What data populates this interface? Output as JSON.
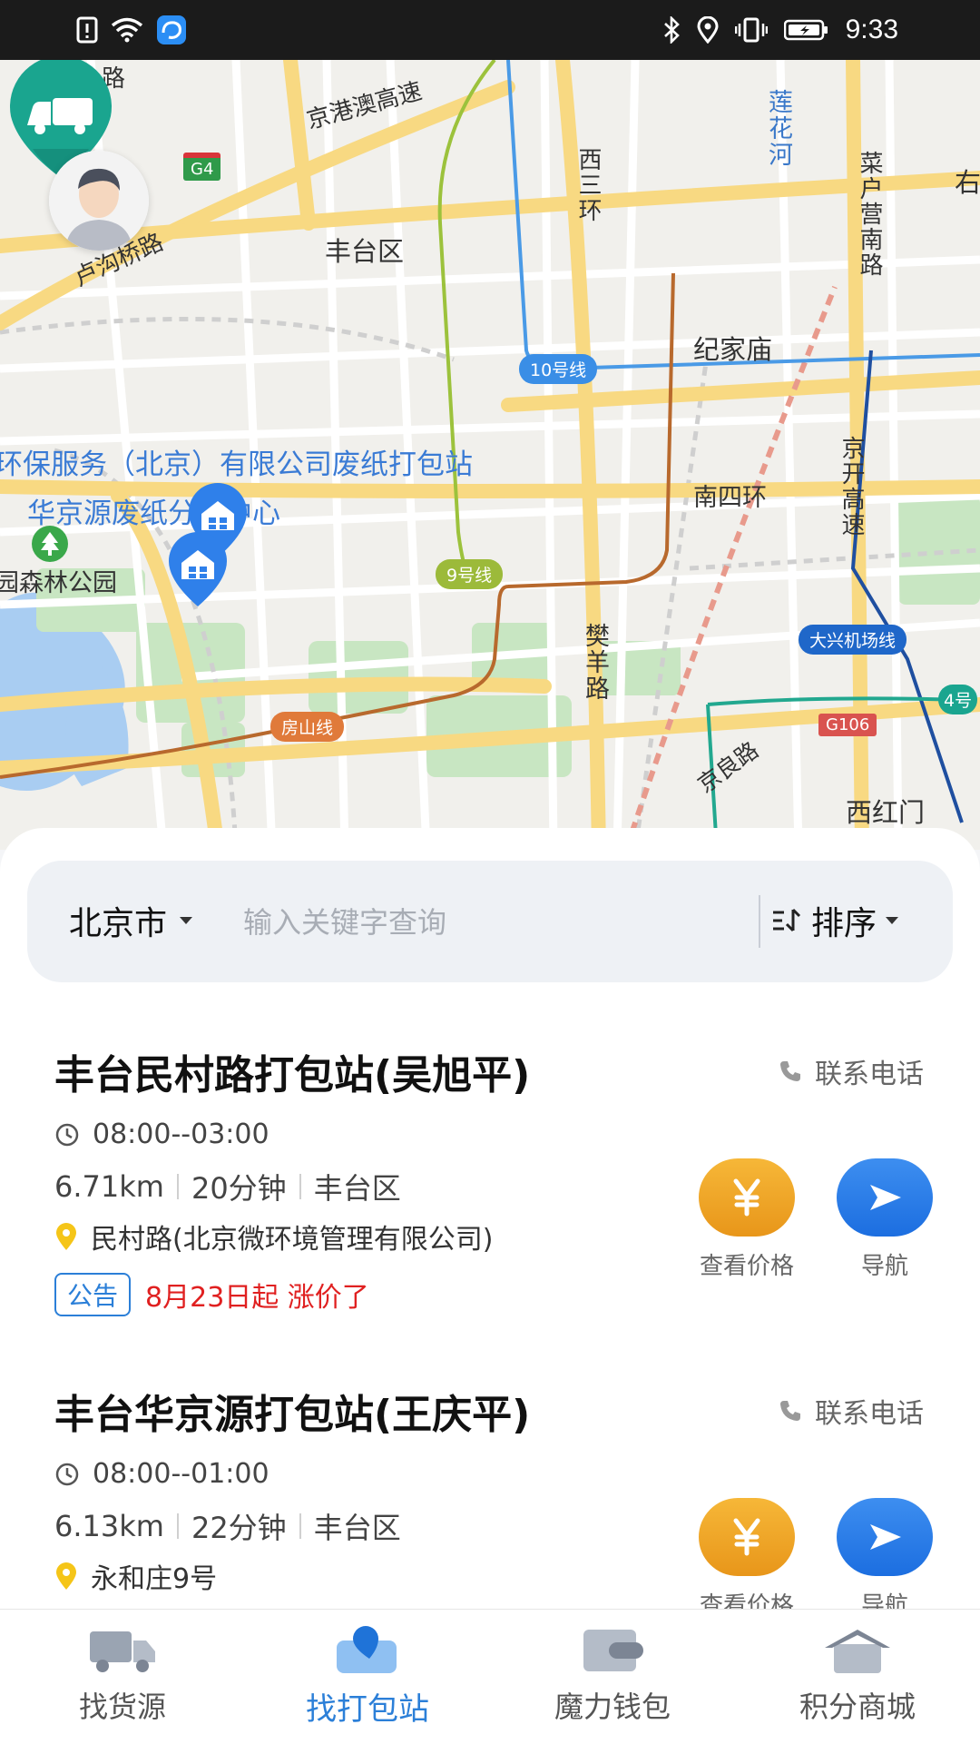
{
  "status_bar": {
    "time": "9:33"
  },
  "map": {
    "labels": {
      "district": "丰台区",
      "jingang": "京港澳高速",
      "lugou": "卢沟桥路",
      "xisanhuan": "西三环",
      "lianhuahe": "莲花河",
      "caihu": "菜户营南路",
      "jijiamiao": "纪家庙",
      "nansihuan": "南四环",
      "jingkai": "京开高速",
      "fanyang": "樊羊路",
      "jingliang": "京良路",
      "xihongmen": "西红门",
      "poi_paper": "环保服务（北京）有限公司废纸打包站",
      "poi_huajing": "华京源废纸分拣中心",
      "park": "园森林公园",
      "top_road": "路",
      "right_edge": "右"
    },
    "badges": {
      "line10": "10号线",
      "line9": "9号线",
      "fangshan": "房山线",
      "daxing": "大兴机场线",
      "g4": "G4",
      "g106": "G106",
      "line4": "4号"
    }
  },
  "search": {
    "city": "北京市",
    "placeholder": "输入关键字查询",
    "sort_label": "排序"
  },
  "stations": [
    {
      "name": "丰台民村路打包站(吴旭平)",
      "phone_label": "联系电话",
      "hours": "08:00--03:00",
      "distance": "6.71km",
      "duration": "20分钟",
      "district": "丰台区",
      "address": "民村路(北京微环境管理有限公司)",
      "notice_tag": "公告",
      "notice": "8月23日起 涨价了",
      "price_label": "查看价格",
      "nav_label": "导航"
    },
    {
      "name": "丰台华京源打包站(王庆平)",
      "phone_label": "联系电话",
      "hours": "08:00--01:00",
      "distance": "6.13km",
      "duration": "22分钟",
      "district": "丰台区",
      "address": "永和庄9号",
      "price_label": "查看价格",
      "nav_label": "导航"
    }
  ],
  "bottom_nav": [
    {
      "label": "找货源",
      "icon": "truck-icon",
      "active": false
    },
    {
      "label": "找打包站",
      "icon": "map-pin-icon",
      "active": true
    },
    {
      "label": "魔力钱包",
      "icon": "wallet-icon",
      "active": false
    },
    {
      "label": "积分商城",
      "icon": "store-icon",
      "active": false
    }
  ],
  "colors": {
    "accent": "#2b7fd8",
    "price_button": "#f0a82a",
    "nav_button": "#2f80ea",
    "notice": "#e02020",
    "marker": "#1aa58f"
  }
}
